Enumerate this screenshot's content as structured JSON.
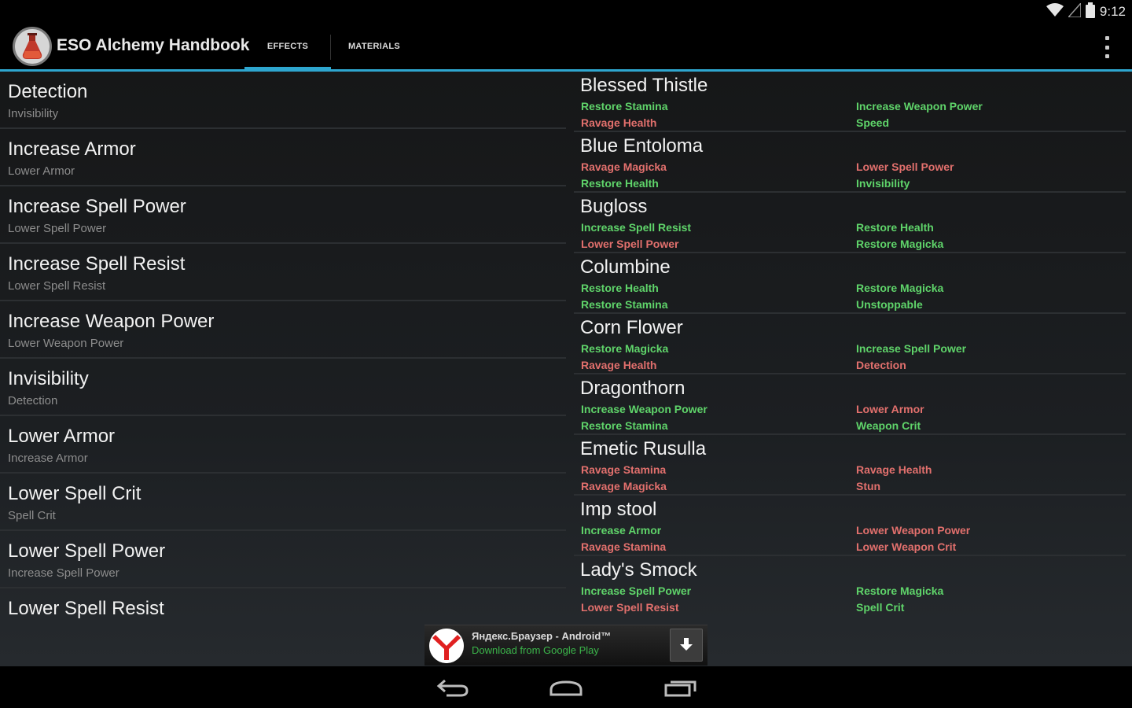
{
  "status_bar": {
    "time": "9:12",
    "icons": [
      "wifi-icon",
      "signal-icon",
      "battery-icon"
    ]
  },
  "app": {
    "title": "ESO Alchemy Handbook",
    "icon": "flask-icon",
    "accent_color": "#2ea6cf"
  },
  "tabs": [
    {
      "label": "EFFECTS",
      "selected": true
    },
    {
      "label": "MATERIALS",
      "selected": false
    }
  ],
  "colors": {
    "positive_effect": "#5fd46a",
    "negative_effect": "#e2706d"
  },
  "effects": [
    {
      "name": "Detection",
      "opposite": "Invisibility"
    },
    {
      "name": "Increase Armor",
      "opposite": "Lower Armor"
    },
    {
      "name": "Increase Spell Power",
      "opposite": "Lower Spell Power"
    },
    {
      "name": "Increase Spell Resist",
      "opposite": "Lower Spell Resist"
    },
    {
      "name": "Increase Weapon Power",
      "opposite": "Lower Weapon Power"
    },
    {
      "name": "Invisibility",
      "opposite": "Detection"
    },
    {
      "name": "Lower Armor",
      "opposite": "Increase Armor"
    },
    {
      "name": "Lower Spell Crit",
      "opposite": "Spell Crit"
    },
    {
      "name": "Lower Spell Power",
      "opposite": "Increase Spell Power"
    },
    {
      "name": "Lower Spell Resist",
      "opposite": ""
    }
  ],
  "ingredients": [
    {
      "name": "Blessed Thistle",
      "effects": [
        "Restore Stamina",
        "Increase Weapon Power",
        "Ravage Health",
        "Speed"
      ],
      "polarity": [
        "pos",
        "pos",
        "neg",
        "pos"
      ]
    },
    {
      "name": "Blue Entoloma",
      "effects": [
        "Ravage Magicka",
        "Lower Spell Power",
        "Restore Health",
        "Invisibility"
      ],
      "polarity": [
        "neg",
        "neg",
        "pos",
        "pos"
      ]
    },
    {
      "name": "Bugloss",
      "effects": [
        "Increase Spell Resist",
        "Restore Health",
        "Lower Spell Power",
        "Restore Magicka"
      ],
      "polarity": [
        "pos",
        "pos",
        "neg",
        "pos"
      ]
    },
    {
      "name": "Columbine",
      "effects": [
        "Restore Health",
        "Restore Magicka",
        "Restore Stamina",
        "Unstoppable"
      ],
      "polarity": [
        "pos",
        "pos",
        "pos",
        "pos"
      ]
    },
    {
      "name": "Corn Flower",
      "effects": [
        "Restore Magicka",
        "Increase Spell Power",
        "Ravage Health",
        "Detection"
      ],
      "polarity": [
        "pos",
        "pos",
        "neg",
        "neg"
      ]
    },
    {
      "name": "Dragonthorn",
      "effects": [
        "Increase Weapon Power",
        "Lower Armor",
        "Restore Stamina",
        "Weapon Crit"
      ],
      "polarity": [
        "pos",
        "neg",
        "pos",
        "pos"
      ]
    },
    {
      "name": "Emetic Rusulla",
      "effects": [
        "Ravage Stamina",
        "Ravage Health",
        "Ravage Magicka",
        "Stun"
      ],
      "polarity": [
        "neg",
        "neg",
        "neg",
        "neg"
      ]
    },
    {
      "name": "Imp stool",
      "effects": [
        "Increase Armor",
        "Lower Weapon Power",
        "Ravage Stamina",
        "Lower Weapon Crit"
      ],
      "polarity": [
        "pos",
        "neg",
        "neg",
        "neg"
      ]
    },
    {
      "name": "Lady's Smock",
      "effects": [
        "Increase Spell Power",
        "Restore Magicka",
        "Lower Spell Resist",
        "Spell Crit"
      ],
      "polarity": [
        "pos",
        "pos",
        "neg",
        "pos"
      ]
    }
  ],
  "ad": {
    "title": "Яндекс.Браузер - Android™",
    "subtitle": "Download from Google Play",
    "icon": "yandex-browser-logo",
    "button_icon": "download-icon"
  },
  "navigation": {
    "buttons": [
      "back-icon",
      "home-icon",
      "recent-apps-icon"
    ]
  }
}
